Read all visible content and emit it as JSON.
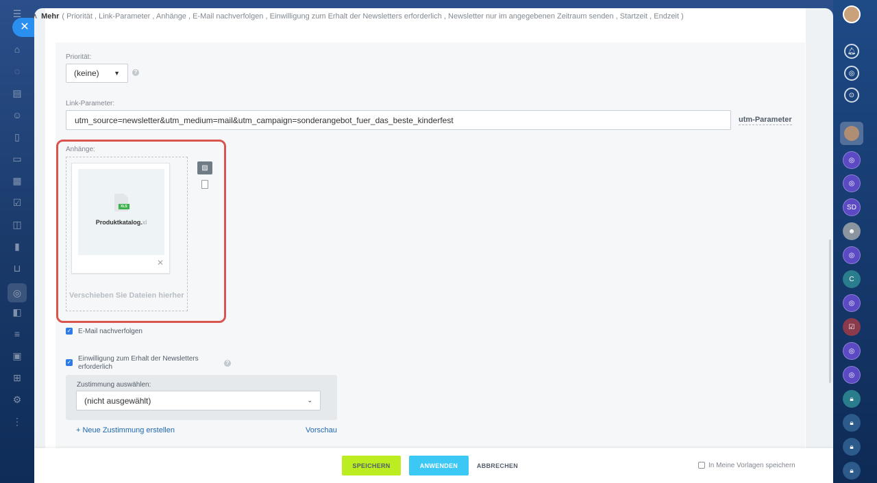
{
  "colors": {
    "accent": "#2f7be5",
    "save_btn": "#bbed21",
    "apply_btn": "#3bc8f5",
    "highlight": "#d9534f"
  },
  "mehr": {
    "title": "Mehr",
    "items": "( Priorität , Link-Parameter , Anhänge , E-Mail nachverfolgen , Einwilligung zum Erhalt der Newsletters erforderlich , Newsletter nur im angegebenen Zeitraum senden , Startzeit , Endzeit )"
  },
  "priority": {
    "label": "Priorität:",
    "value": "(keine)"
  },
  "link_params": {
    "label": "Link-Parameter:",
    "value": "utm_source=newsletter&utm_medium=mail&utm_campaign=sonderangebot_fuer_das_beste_kinderfest",
    "utm_label": "utm-Parameter"
  },
  "attachments": {
    "label": "Anhänge:",
    "file_badge": "XLS",
    "file_name": "Produktkatalog.",
    "file_ext": "xl",
    "drop_text": "Verschieben Sie Dateien hierher"
  },
  "email_tracking": {
    "label": "E-Mail nachverfolgen",
    "checked": true
  },
  "consent": {
    "label": "Einwilligung zum Erhalt der Newsletters erforderlich",
    "checked": true,
    "select_label": "Zustimmung auswählen:",
    "select_value": "(nicht ausgewählt)",
    "new_link": "+ Neue Zustimmung erstellen",
    "preview_link": "Vorschau"
  },
  "footer": {
    "save": "SPEICHERN",
    "apply": "ANWENDEN",
    "cancel": "ABBRECHEN",
    "template": "In Meine Vorlagen speichern"
  },
  "right_bar": {
    "badge_sd": "SD",
    "badge_c": "C"
  }
}
